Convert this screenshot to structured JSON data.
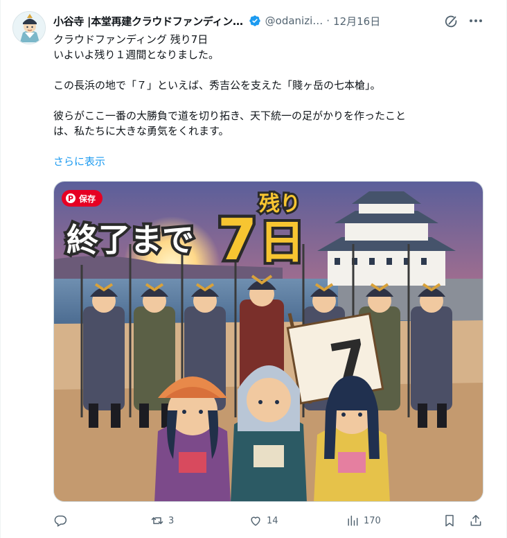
{
  "post": {
    "author_name": "小谷寺 |本堂再建クラウドファンディン…",
    "handle": "@odanizi…",
    "separator": "·",
    "date": "12月16日",
    "text_lines": [
      "クラウドファンディング 残り7日",
      "いよいよ残り１週間となりました。",
      "",
      "この長浜の地で「７」といえば、秀吉公を支えた「賤ヶ岳の七本槍」。",
      "",
      "彼らがここ一番の大勝負で道を切り拓き、天下統一の足がかりを作ったこと",
      "は、私たちに大きな勇気をくれます。"
    ],
    "show_more": "さらに表示"
  },
  "media": {
    "save_label": "保存",
    "pinterest_glyph": "P",
    "headline": "終了まで",
    "number": "7",
    "day_char": "日",
    "remaining": "残り",
    "banner_number": "7"
  },
  "actions": {
    "replies": "",
    "reposts": "3",
    "likes": "14",
    "views": "170"
  },
  "icons": [
    "verified-badge-icon",
    "grok-icon",
    "more-icon",
    "reply-icon",
    "repost-icon",
    "like-icon",
    "views-icon",
    "bookmark-icon",
    "share-icon",
    "pinterest-icon"
  ],
  "colors": {
    "accent": "#1d9bf0",
    "muted": "#536471",
    "pinterest": "#e60023",
    "headline_yellow": "#f7c531"
  }
}
